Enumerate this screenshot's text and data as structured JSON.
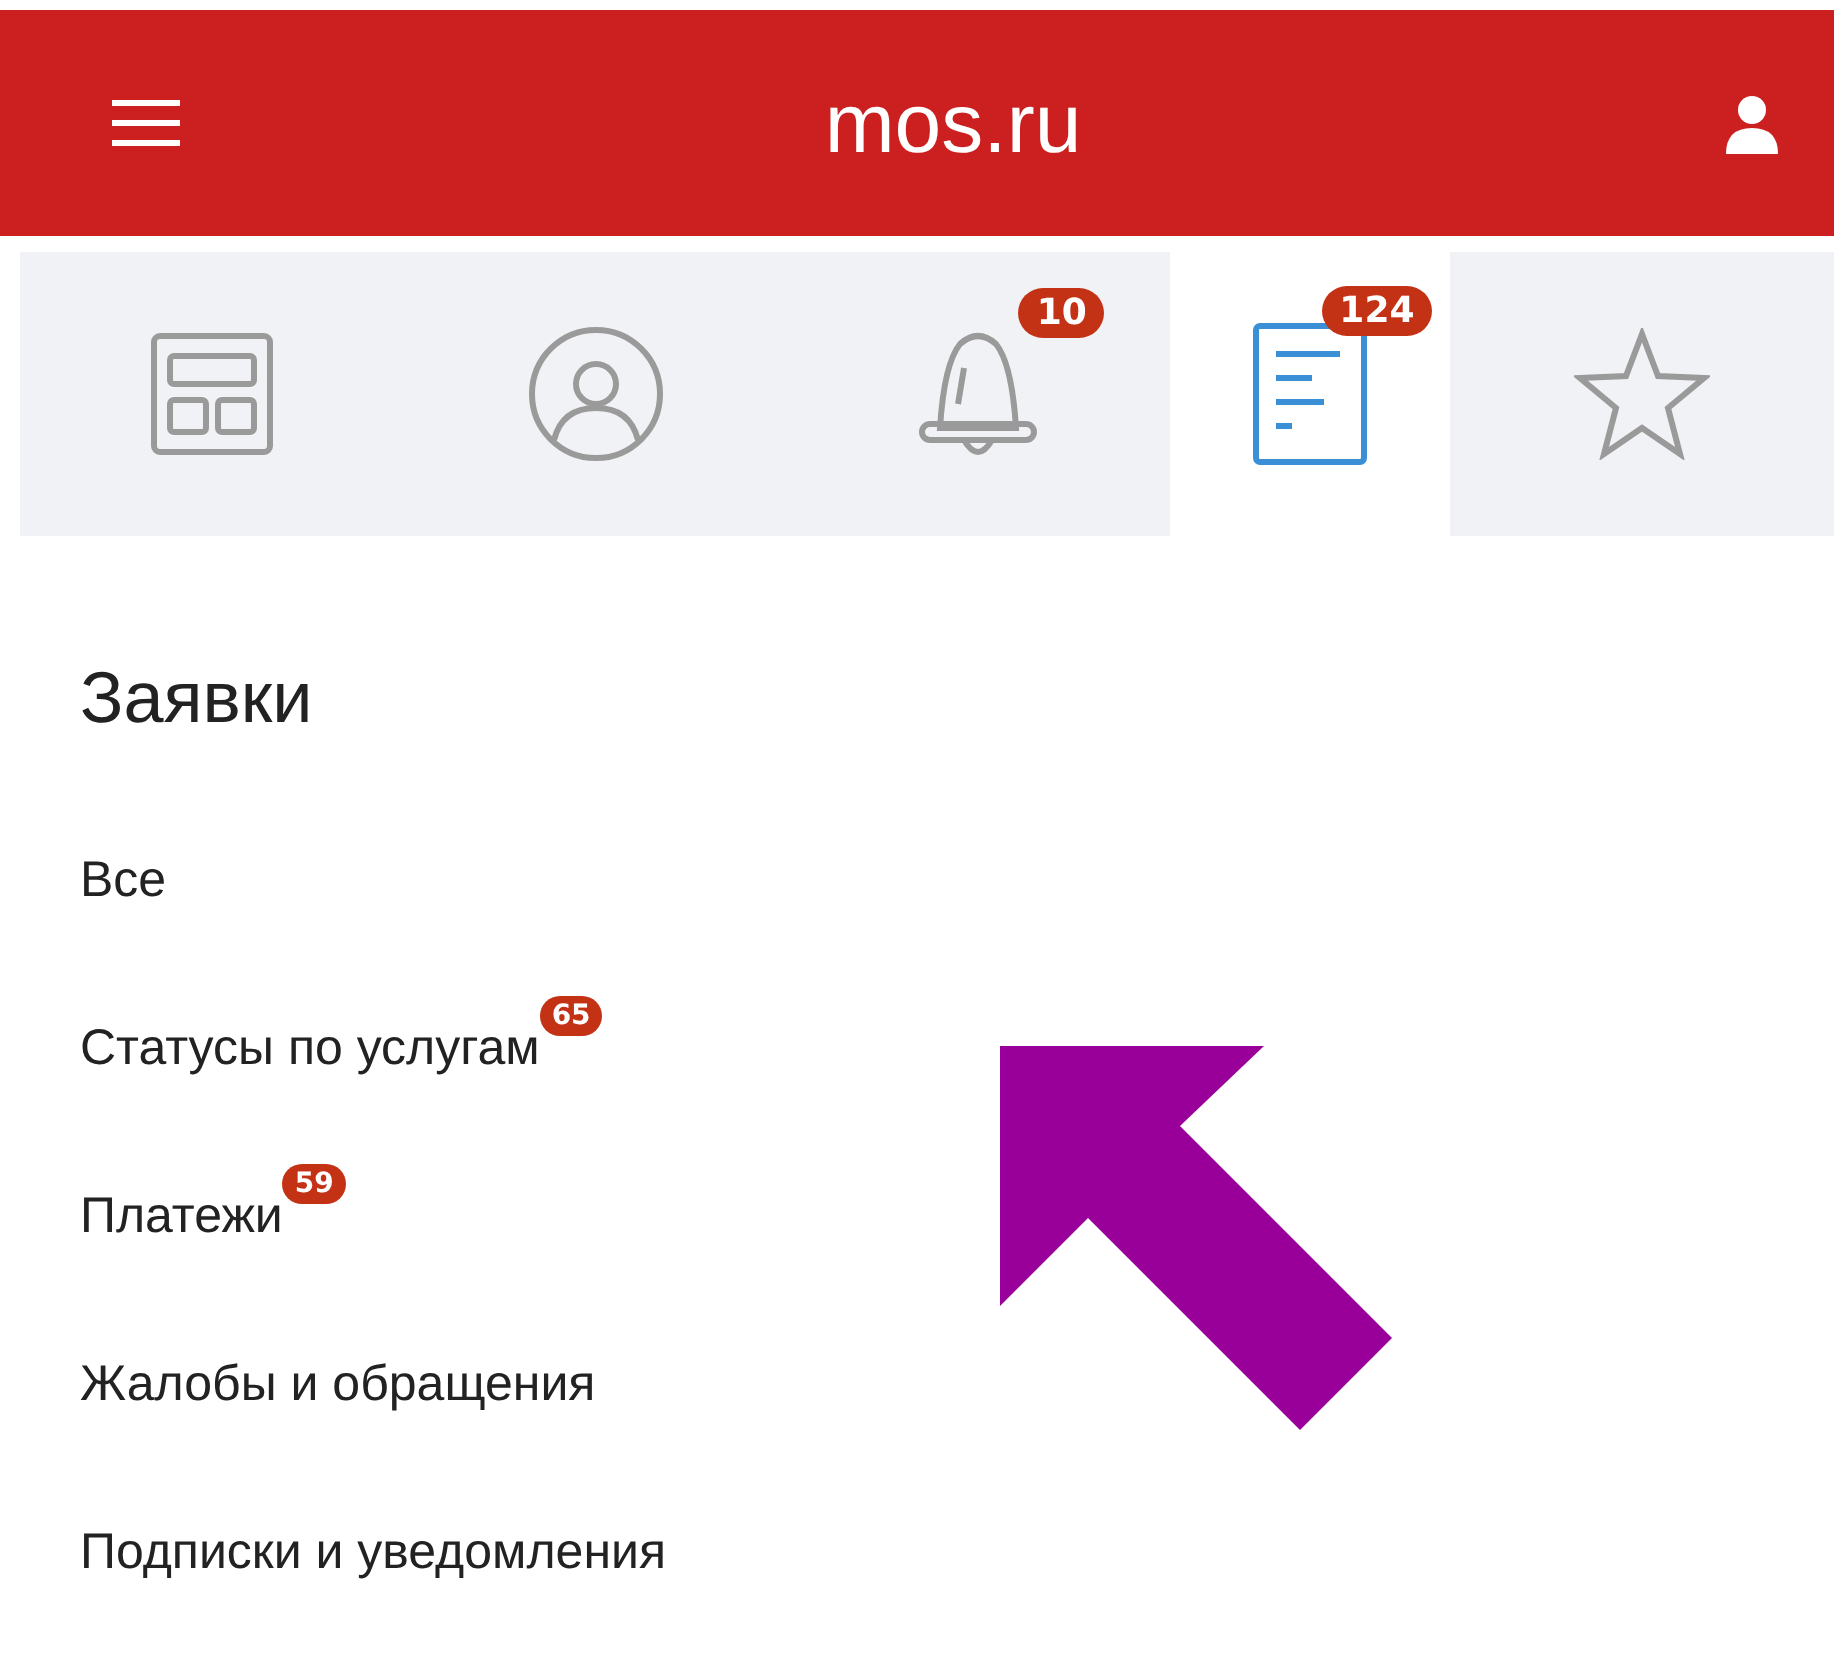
{
  "header": {
    "title": "mos.ru"
  },
  "tabs": [
    {
      "kind": "widgets",
      "selected": false
    },
    {
      "kind": "profile",
      "selected": false
    },
    {
      "kind": "bell",
      "selected": false,
      "badge": "10"
    },
    {
      "kind": "document",
      "selected": true,
      "badge": "124"
    },
    {
      "kind": "star",
      "selected": false
    }
  ],
  "section": {
    "title": "Заявки"
  },
  "items": [
    {
      "label": "Все"
    },
    {
      "label": "Статусы по услугам",
      "badge": "65"
    },
    {
      "label": "Платежи",
      "badge": "59"
    },
    {
      "label": "Жалобы и обращения"
    },
    {
      "label": "Подписки и уведомления"
    }
  ]
}
